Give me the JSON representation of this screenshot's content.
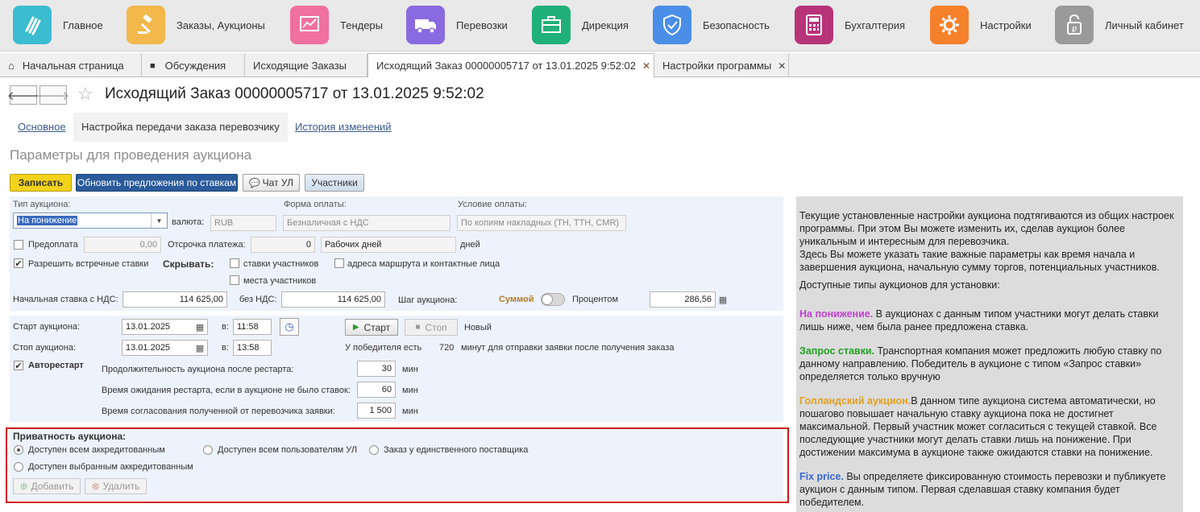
{
  "sections": [
    {
      "label": "Главное",
      "icon": "main-icon",
      "color": "#3bbcd0"
    },
    {
      "label": "Заказы, Аукционы",
      "icon": "gavel-icon",
      "color": "#f2b84b"
    },
    {
      "label": "Тендеры",
      "icon": "chart-icon",
      "color": "#f070a0"
    },
    {
      "label": "Перевозки",
      "icon": "truck-icon",
      "color": "#8a6ae0"
    },
    {
      "label": "Дирекция",
      "icon": "briefcase-icon",
      "color": "#20b07a"
    },
    {
      "label": "Безопасность",
      "icon": "shield-icon",
      "color": "#4a8ee8"
    },
    {
      "label": "Бухгалтерия",
      "icon": "calculator-icon",
      "color": "#b8347a"
    },
    {
      "label": "Настройки",
      "icon": "gear-icon",
      "color": "#f5812a"
    },
    {
      "label": "Личный кабинет",
      "icon": "lock-icon",
      "color": "#9a9a9a"
    }
  ],
  "tabs": [
    {
      "label": "Начальная страница"
    },
    {
      "label": "Обсуждения"
    },
    {
      "label": "Исходящие Заказы"
    },
    {
      "label": "Исходящий Заказ 00000005717 от 13.01.2025 9:52:02"
    },
    {
      "label": "Настройки программы"
    }
  ],
  "header": {
    "title": "Исходящий Заказ 00000005717 от 13.01.2025 9:52:02",
    "subtabs": [
      "Основное",
      "Настройка передачи заказа перевозчику",
      "История изменений"
    ],
    "section_title": "Параметры для проведения аукциона"
  },
  "toolbar": {
    "save": "Записать",
    "refresh": "Обновить предложения по ставкам",
    "chat": "Чат УЛ",
    "participants": "Участники"
  },
  "auction": {
    "type_label": "Тип аукциона:",
    "type_value": "На понижение",
    "currency_label": "валюта:",
    "currency_value": "RUB",
    "payment_form_label": "Форма оплаты:",
    "payment_form_value": "Безналичная с НДС",
    "payment_cond_label": "Условие оплаты:",
    "payment_cond_value": "По копиям накладных (ТН, ТТН, CMR)",
    "prepay_label": "Предоплата",
    "prepay_value": "0,00",
    "delay_label": "Отсрочка платежа:",
    "delay_value": "0",
    "delay_unit_value": "Рабочих дней",
    "delay_unit_suffix": "дней",
    "counter_bids_label": "Разрешить встречные ставки",
    "hide_label": "Скрывать:",
    "hide_bids": "ставки участников",
    "hide_addresses": "адреса маршрута и контактные лица",
    "hide_places": "места участников",
    "start_rate_label": "Начальная ставка с НДС:",
    "start_rate_value": "114 625,00",
    "no_vat_label": "без НДС:",
    "no_vat_value": "114 625,00",
    "step_label": "Шаг аукциона:",
    "step_sum": "Суммой",
    "step_percent": "Процентом",
    "step_value": "286,56"
  },
  "schedule": {
    "start_label": "Старт аукциона:",
    "start_date": "13.01.2025",
    "start_time_label": "в:",
    "start_time": "11:58",
    "stop_label": "Стоп аукциона:",
    "stop_date": "13.01.2025",
    "stop_time_label": "в:",
    "stop_time": "13:58",
    "btn_start": "Старт",
    "btn_stop": "Стоп",
    "status": "Новый",
    "winner_prefix": "У победителя есть",
    "winner_minutes": "720",
    "winner_suffix": "минут для отправки заявки после получения заказа",
    "autorestart_label": "Авторестарт",
    "restart_duration_label": "Продолжительность аукциона после рестарта:",
    "restart_duration_value": "30",
    "restart_wait_label": "Время ожидания рестарта, если в аукционе не было ставок:",
    "restart_wait_value": "60",
    "approval_label": "Время согласования полученной от перевозчика заявки:",
    "approval_value": "1 500",
    "unit": "мин"
  },
  "privacy": {
    "title": "Приватность аукциона:",
    "opt_all_accredited": "Доступен всем аккредитованным",
    "opt_all_users": "Доступен всем пользователям УЛ",
    "opt_single": "Заказ у единственного поставщика",
    "opt_selected": "Доступен выбранным аккредитованным",
    "add": "Добавить",
    "remove": "Удалить"
  },
  "help": {
    "intro1": "Текущие установленные настройки аукциона подтягиваются из общих настроек программы. При этом Вы можете изменить их, сделав аукцион более уникальным и интересным для перевозчика.",
    "intro2": "Здесь Вы можете указать такие важные параметры как время начала и завершения аукциона, начальную сумму торгов, потенциальных участников.",
    "intro3": "Доступные типы аукционов для установки:",
    "t1_name": "На понижение.",
    "t1_text": " В аукционах с данным типом участники могут делать ставки лишь ниже, чем была ранее предложена ставка.",
    "t2_name": "Запрос ставки.",
    "t2_text": " Транспортная компания может предложить любую ставку по данному направлению. Победитель в аукционе с типом «Запрос ставки» определяется только вручную",
    "t3_name": "Голландский аукцион.",
    "t3_text": "В данном типе аукциона система автоматически, но пошагово повышает начальную ставку аукциона пока не достигнет максимальной. Первый участник может согласиться с текущей ставкой. Все последующие участники могут делать ставки лишь на понижение. При достижении максимума в аукционе также ожидаются ставки на понижение.",
    "t4_name": "Fix price.",
    "t4_text": " Вы определяете фиксированную стоимость перевозки и публикуете аукцион с данным типом. Первая сделавшая ставку компания будет победителем."
  },
  "colors": {
    "t1": "#c040d0",
    "t2": "#22a022",
    "t3": "#e0a020",
    "t4": "#3a6ad0",
    "highlight": "#d0141c",
    "save_button": "#f2d21a",
    "primary_button": "#2a5a9a"
  }
}
